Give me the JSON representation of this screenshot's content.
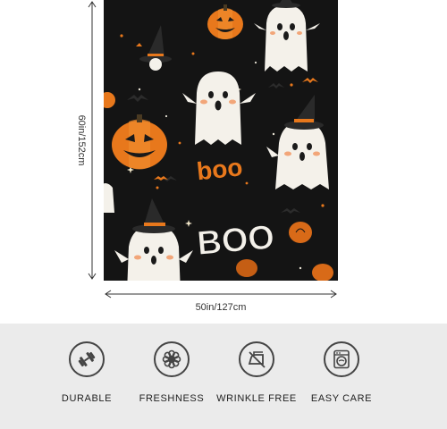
{
  "product": {
    "height_label": "60in/152cm",
    "width_label": "50in/127cm",
    "print_text": {
      "orange_word": "boo",
      "white_word": "BOO"
    }
  },
  "features": [
    {
      "label": "DURABLE",
      "icon": "dumbbell-icon"
    },
    {
      "label": "FRESHNESS",
      "icon": "flower-icon"
    },
    {
      "label": "WRINKLE FREE",
      "icon": "iron-icon"
    },
    {
      "label": "EASY CARE",
      "icon": "washing-machine-icon"
    }
  ],
  "colors": {
    "blanket_background": "#141414",
    "pumpkin_orange": "#e8781c",
    "ghost_white": "#f4f1ea",
    "feature_band": "#ebebeb"
  }
}
